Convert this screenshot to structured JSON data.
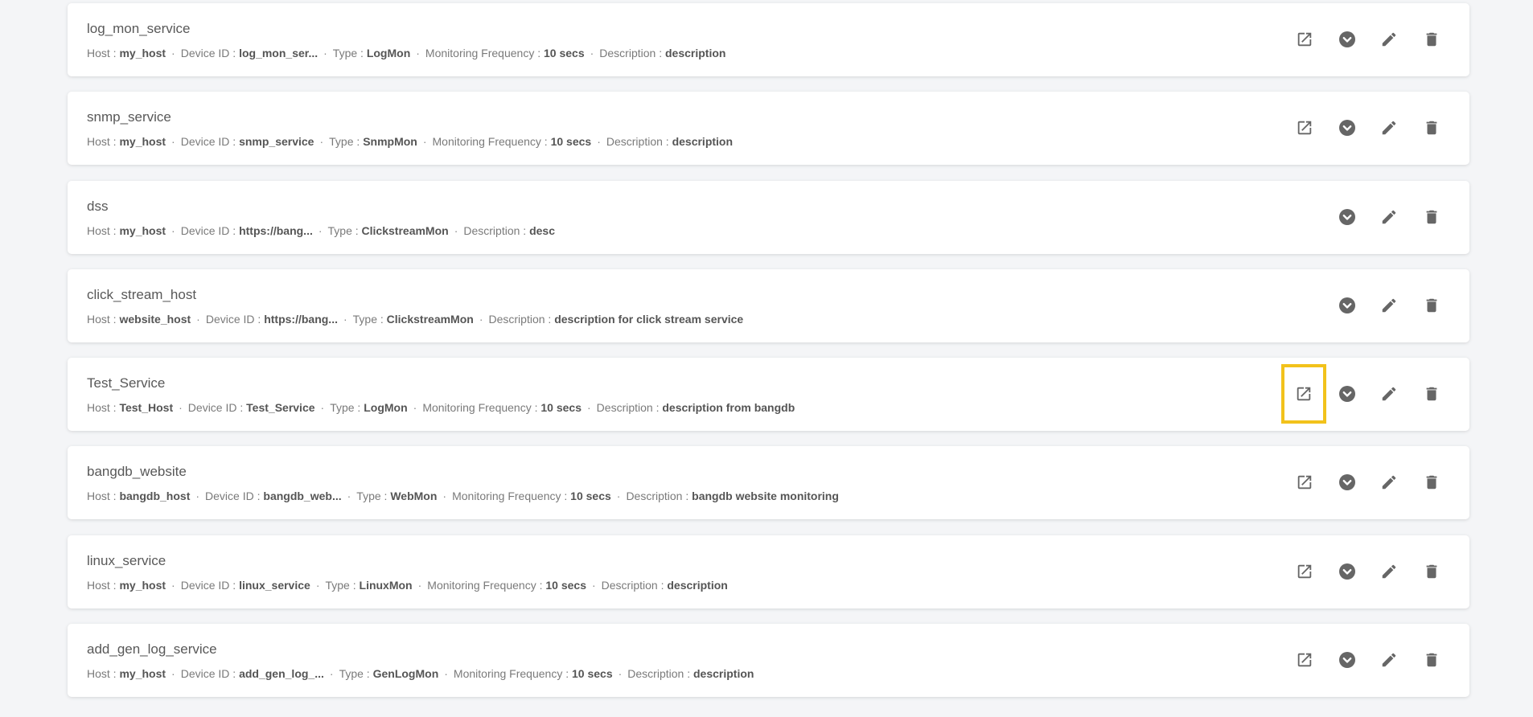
{
  "colors": {
    "background": "#f4f5f7",
    "card": "#ffffff",
    "icon": "#666666",
    "highlight": "#f2c21b"
  },
  "labels": {
    "host": "Host :",
    "device_id": "Device ID :",
    "type": "Type :",
    "frequency": "Monitoring Frequency :",
    "description": "Description :"
  },
  "icons": {
    "open": "open-in-new-icon",
    "expand": "chevron-down-circle-icon",
    "edit": "pencil-icon",
    "delete": "trash-icon"
  },
  "services": [
    {
      "name": "log_mon_service",
      "host": "my_host",
      "device_id": "log_mon_ser...",
      "type": "LogMon",
      "frequency": "10 secs",
      "description": "description",
      "has_open": true,
      "highlighted": false
    },
    {
      "name": "snmp_service",
      "host": "my_host",
      "device_id": "snmp_service",
      "type": "SnmpMon",
      "frequency": "10 secs",
      "description": "description",
      "has_open": true,
      "highlighted": false
    },
    {
      "name": "dss",
      "host": "my_host",
      "device_id": "https://bang...",
      "type": "ClickstreamMon",
      "frequency": null,
      "description": "desc",
      "has_open": false,
      "highlighted": false
    },
    {
      "name": "click_stream_host",
      "host": "website_host",
      "device_id": "https://bang...",
      "type": "ClickstreamMon",
      "frequency": null,
      "description": "description for click stream service",
      "has_open": false,
      "highlighted": false
    },
    {
      "name": "Test_Service",
      "host": "Test_Host",
      "device_id": "Test_Service",
      "type": "LogMon",
      "frequency": "10 secs",
      "description": "description from bangdb",
      "has_open": true,
      "highlighted": true
    },
    {
      "name": "bangdb_website",
      "host": "bangdb_host",
      "device_id": "bangdb_web...",
      "type": "WebMon",
      "frequency": "10 secs",
      "description": "bangdb website monitoring",
      "has_open": true,
      "highlighted": false
    },
    {
      "name": "linux_service",
      "host": "my_host",
      "device_id": "linux_service",
      "type": "LinuxMon",
      "frequency": "10 secs",
      "description": "description",
      "has_open": true,
      "highlighted": false
    },
    {
      "name": "add_gen_log_service",
      "host": "my_host",
      "device_id": "add_gen_log_...",
      "type": "GenLogMon",
      "frequency": "10 secs",
      "description": "description",
      "has_open": true,
      "highlighted": false
    }
  ]
}
